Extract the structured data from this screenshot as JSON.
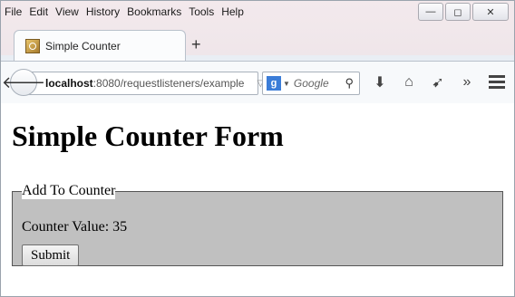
{
  "menu": {
    "items": [
      "File",
      "Edit",
      "View",
      "History",
      "Bookmarks",
      "Tools",
      "Help"
    ]
  },
  "window_controls": {
    "minimize": "—",
    "maximize": "◻",
    "close": "✕"
  },
  "tab": {
    "title": "Simple Counter",
    "new_tab": "+"
  },
  "address_bar": {
    "host": "localhost",
    "path": ":8080/requestlisteners/example"
  },
  "search_bar": {
    "engine_letter": "g",
    "placeholder": "Google"
  },
  "toolbar": {
    "icons": [
      "download-icon",
      "home-icon",
      "share-icon",
      "overflow-icon",
      "menu-icon"
    ]
  },
  "page": {
    "heading": "Simple Counter Form",
    "fieldset_legend": "Add To Counter",
    "counter_label": "Counter Value:",
    "counter_value": "35",
    "submit_label": "Submit"
  }
}
